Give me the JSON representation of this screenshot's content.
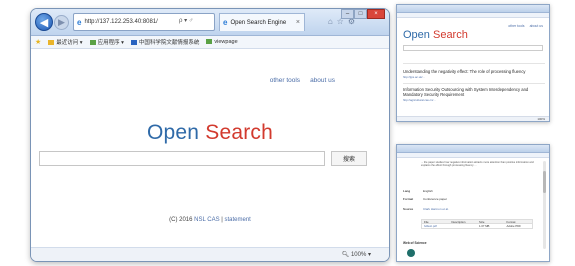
{
  "main_browser": {
    "address": "http://137.122.253.40:8081/",
    "address_controls": "ρ ▾ ♂",
    "tab_title": "Open Search Engine",
    "fav_items": [
      "最近访问 ▾",
      "应用程序 ▾",
      "中国科学院文献情报系统",
      "viewpage"
    ],
    "top_links": [
      "other tools",
      "about us"
    ],
    "logo_open": "Open",
    "logo_search": "Search",
    "search_button": "搜索",
    "footer_prefix": "(C) 2016",
    "footer_link1": "NSL CAS",
    "footer_sep": " | ",
    "footer_link2": "statement",
    "zoom": "100%"
  },
  "results_window": {
    "links": [
      "other tools",
      "about us"
    ],
    "logo_open": "Open",
    "logo_search": "Search",
    "results": [
      {
        "title": "Understanding the negativity effect: The role of processing fluency",
        "meta": "http://jips.ac.uk/..."
      },
      {
        "title": "Information Security Outsourcing with System Interdependency and Mandatory Security Requirement",
        "meta": "http://agricultural.cas.cn/..."
      }
    ],
    "zoom": "100%"
  },
  "detail_window": {
    "paragraph": "... the paper studies how negative information attracts more attention than positive information and explains the effect through processing fluency ...",
    "rows": [
      {
        "key": "Lang",
        "value": "English"
      },
      {
        "key": "Format",
        "value": "Conference paper"
      },
      {
        "key": "Source",
        "value": "Clark Harmon et al."
      }
    ],
    "table_headers": [
      "File",
      "Description",
      "Size",
      "Format"
    ],
    "table_row": [
      "fulltext.pdf",
      "",
      "1.07 MB",
      "Adobe PDF"
    ],
    "metrics_title": "Web of Science"
  },
  "colors": {
    "logo_blue": "#2f6aa8",
    "logo_red": "#d23a2e",
    "link_blue": "#4c6ea8"
  }
}
